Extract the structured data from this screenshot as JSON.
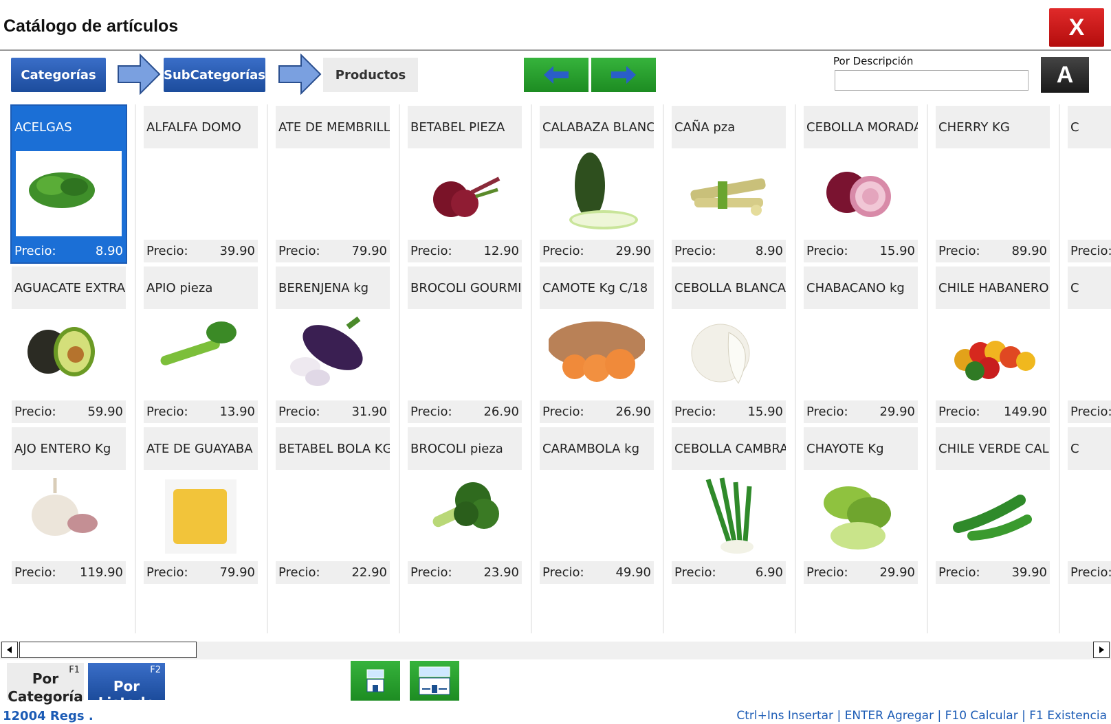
{
  "window": {
    "title": "Catálogo de artículos",
    "close_label": "X"
  },
  "breadcrumb": {
    "categorias": "Categorías",
    "subcategorias": "SubCategorías",
    "productos": "Productos"
  },
  "search": {
    "label": "Por Descripción",
    "value": "",
    "keyboard_label": "A"
  },
  "price_label": "Precio:",
  "columns": [
    [
      {
        "name": "ACELGAS",
        "price": "8.90",
        "icon": "chard",
        "selected": true
      },
      {
        "name": "AGUACATE EXTRA",
        "price": "59.90",
        "icon": "avocado"
      },
      {
        "name": "AJO ENTERO Kg",
        "price": "119.90",
        "icon": "garlic"
      }
    ],
    [
      {
        "name": "ALFALFA DOMO",
        "price": "39.90",
        "icon": ""
      },
      {
        "name": "APIO pieza",
        "price": "13.90",
        "icon": "celery"
      },
      {
        "name": "ATE DE GUAYABA",
        "price": "79.90",
        "icon": "guava-paste"
      }
    ],
    [
      {
        "name": "ATE DE MEMBRILL",
        "price": "79.90",
        "icon": ""
      },
      {
        "name": "BERENJENA kg",
        "price": "31.90",
        "icon": "eggplant"
      },
      {
        "name": "BETABEL BOLA  KG",
        "price": "22.90",
        "icon": ""
      }
    ],
    [
      {
        "name": "BETABEL PIEZA",
        "price": "12.90",
        "icon": "beet"
      },
      {
        "name": "BROCOLI GOURMI",
        "price": "26.90",
        "icon": ""
      },
      {
        "name": "BROCOLI pieza",
        "price": "23.90",
        "icon": "broccoli"
      }
    ],
    [
      {
        "name": "CALABAZA BLANCA",
        "price": "29.90",
        "icon": "zucchini"
      },
      {
        "name": "CAMOTE Kg  C/18",
        "price": "26.90",
        "icon": "sweet-potato"
      },
      {
        "name": "CARAMBOLA kg",
        "price": "49.90",
        "icon": ""
      }
    ],
    [
      {
        "name": "CAÑA pza",
        "price": "8.90",
        "icon": "sugarcane"
      },
      {
        "name": "CEBOLLA BLANCA",
        "price": "15.90",
        "icon": "white-onion"
      },
      {
        "name": "CEBOLLA CAMBRA",
        "price": "6.90",
        "icon": "green-onion"
      }
    ],
    [
      {
        "name": "CEBOLLA MORADA",
        "price": "15.90",
        "icon": "red-onion"
      },
      {
        "name": "CHABACANO kg",
        "price": "29.90",
        "icon": ""
      },
      {
        "name": "CHAYOTE Kg",
        "price": "29.90",
        "icon": "chayote"
      }
    ],
    [
      {
        "name": "CHERRY KG",
        "price": "89.90",
        "icon": ""
      },
      {
        "name": "CHILE HABANERO",
        "price": "149.90",
        "icon": "habanero"
      },
      {
        "name": "CHILE VERDE  CAL",
        "price": "39.90",
        "icon": "green-chile"
      }
    ],
    [
      {
        "name": "C",
        "price": "",
        "icon": ""
      },
      {
        "name": "C",
        "price": "",
        "icon": ""
      },
      {
        "name": "C",
        "price": "",
        "icon": ""
      }
    ]
  ],
  "modes": {
    "by_category": "Por Categoría",
    "by_category_key": "F1",
    "by_list": "Por Listado",
    "by_list_key": "F2"
  },
  "footer": {
    "records": "12004 Regs  .",
    "shortcuts": "Ctrl+Ins Insertar | ENTER Agregar | F10 Calcular | F1 Existencia"
  },
  "colors": {
    "accent_blue": "#1b6fd6",
    "green": "#2aa531",
    "red": "#cc1b1b"
  }
}
